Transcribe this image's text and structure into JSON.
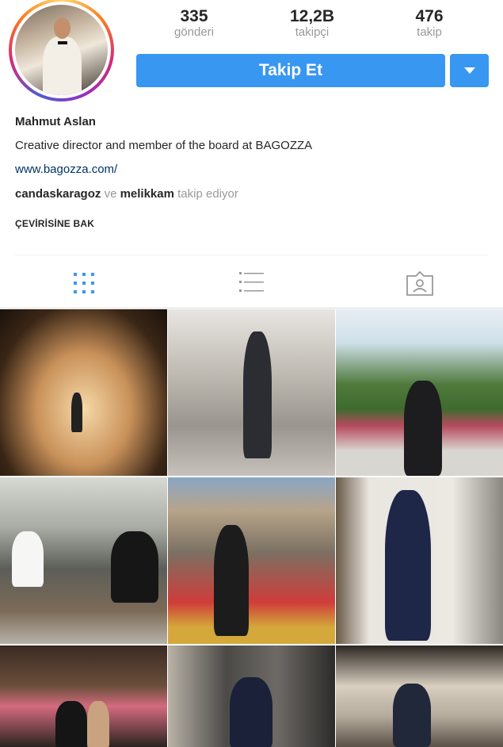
{
  "profile": {
    "name": "Mahmut Aslan",
    "bio": "Creative director and member of the board at BAGOZZA",
    "website": "www.bagozza.com/",
    "followed_by": {
      "user1": "candaskaragoz",
      "joiner": "ve",
      "user2": "melikkam",
      "suffix": "takip ediyor"
    },
    "translate_label": "ÇEVİRİSİNE BAK"
  },
  "stats": {
    "posts": {
      "value": "335",
      "label": "gönderi"
    },
    "followers": {
      "value": "12,2B",
      "label": "takipçi"
    },
    "following": {
      "value": "476",
      "label": "takip"
    }
  },
  "actions": {
    "follow_label": "Takip Et"
  },
  "tabs": {
    "grid_icon": "grid-icon",
    "list_icon": "list-icon",
    "tagged_icon": "tagged-icon"
  },
  "colors": {
    "accent": "#3897f0",
    "link": "#003569",
    "muted": "#999999"
  },
  "posts": [
    {
      "scene": "lit tunnel"
    },
    {
      "scene": "man in suit on stairs"
    },
    {
      "scene": "man in garden"
    },
    {
      "scene": "two men seated on terrace"
    },
    {
      "scene": "man with bicycles"
    },
    {
      "scene": "man in pinstripe suit"
    },
    {
      "scene": "couple with flowers"
    },
    {
      "scene": "man in suit by marble"
    },
    {
      "scene": "man in sweater under arches"
    }
  ]
}
